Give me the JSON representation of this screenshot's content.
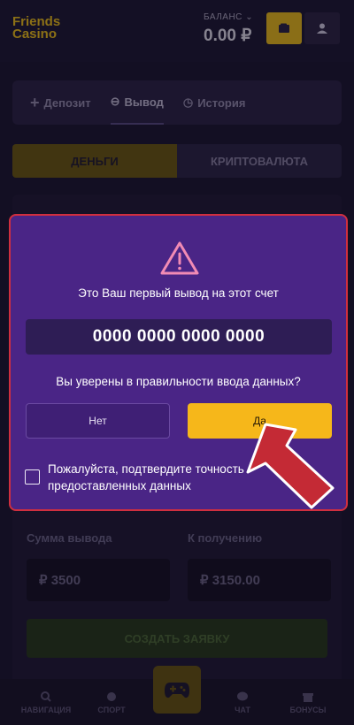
{
  "header": {
    "logo_line1": "Friends",
    "logo_line2": "Casino",
    "balance_label": "БАЛАНС",
    "balance_value": "0.00 ₽"
  },
  "tabs": [
    {
      "label": "Депозит",
      "icon": "plus-icon"
    },
    {
      "label": "Вывод",
      "icon": "minus-circle-icon"
    },
    {
      "label": "История",
      "icon": "history-icon"
    }
  ],
  "segments": {
    "money": "ДЕНЬГИ",
    "crypto": "КРИПТОВАЛЮТА"
  },
  "form": {
    "sum_label": "Сумма вывода",
    "receive_label": "К получению",
    "sum_value": "₽  3500",
    "receive_value": "₽  3150.00",
    "create_button": "СОЗДАТЬ ЗАЯВКУ"
  },
  "bottom_nav": {
    "nav": "НАВИГАЦИЯ",
    "sport": "СПОРТ",
    "chat": "ЧАТ",
    "bonus": "БОНУСЫ"
  },
  "modal": {
    "title": "Это Ваш первый вывод на этот счет",
    "card_number": "0000 0000 0000 0000",
    "question": "Вы уверены в правильности ввода данных?",
    "no_label": "Нет",
    "yes_label": "Да",
    "confirm_label": "Пожалуйста, подтвердите точность предоставленных данных"
  },
  "colors": {
    "accent": "#f6b71a",
    "modal_bg": "#4a2586",
    "modal_border": "#d02f3f",
    "arrow": "#c42a35"
  }
}
